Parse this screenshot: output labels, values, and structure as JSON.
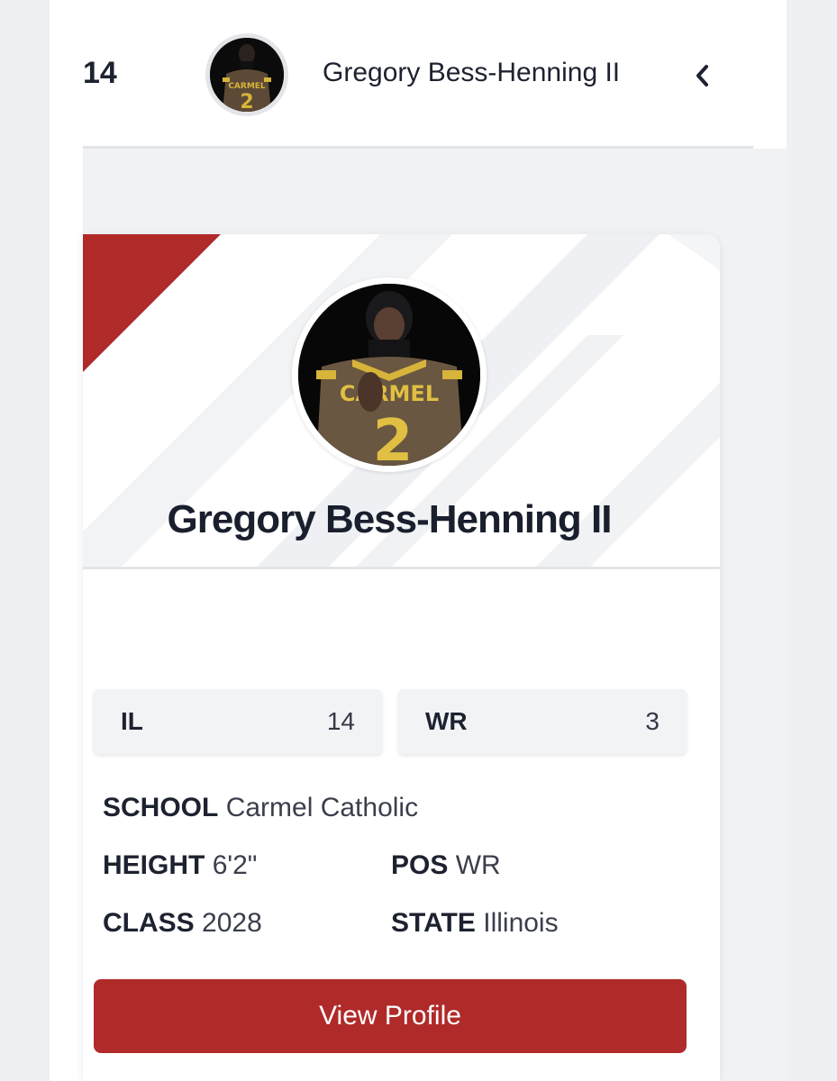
{
  "header": {
    "rank": "14",
    "name": "Gregory Bess-Henning II",
    "avatar_alt": "player-photo",
    "collapse_icon": "chevron-left-icon"
  },
  "card": {
    "name": "Gregory Bess-Henning II",
    "accent_color": "#b02a2a",
    "rankings": [
      {
        "label": "IL",
        "value": "14"
      },
      {
        "label": "WR",
        "value": "3"
      }
    ],
    "school": {
      "label": "SCHOOL",
      "value": "Carmel Catholic"
    },
    "height": {
      "label": "HEIGHT",
      "value": "6'2\""
    },
    "pos": {
      "label": "POS",
      "value": "WR"
    },
    "class": {
      "label": "CLASS",
      "value": "2028"
    },
    "state": {
      "label": "STATE",
      "value": "Illinois"
    },
    "button_label": "View Profile"
  }
}
